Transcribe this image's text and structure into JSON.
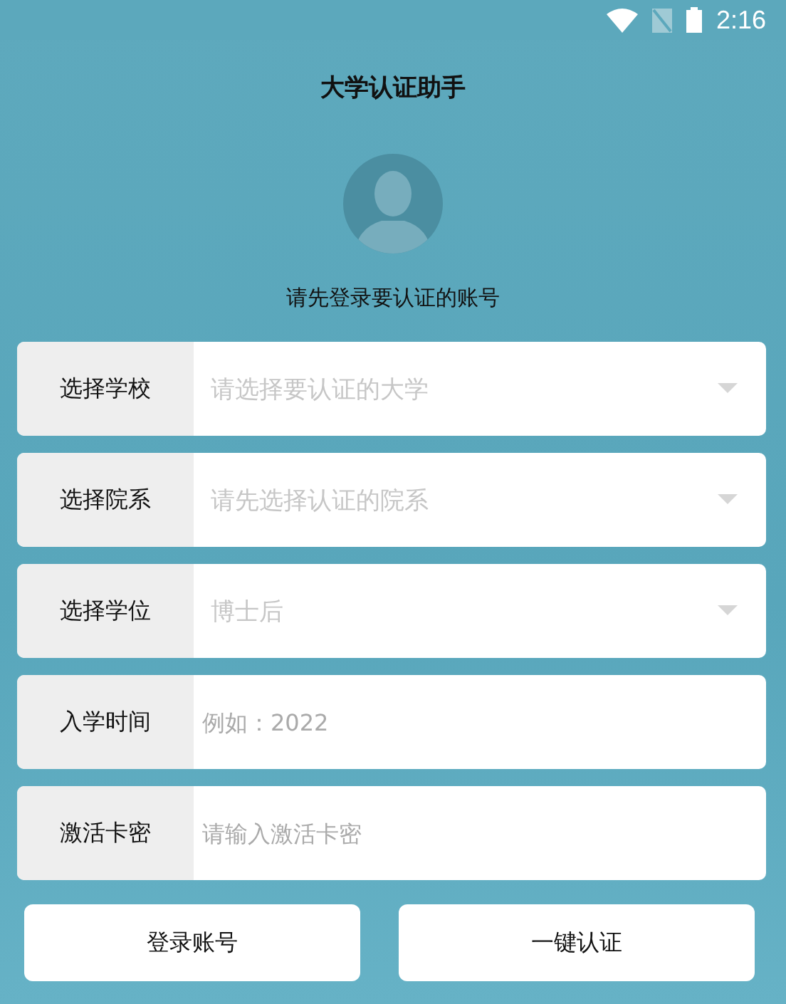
{
  "status_bar": {
    "time": "2:16"
  },
  "title": "大学认证助手",
  "subtitle": "请先登录要认证的账号",
  "fields": [
    {
      "kind": "dropdown",
      "label": "选择学校",
      "placeholder": "请选择要认证的大学"
    },
    {
      "kind": "dropdown",
      "label": "选择院系",
      "placeholder": "请先选择认证的院系"
    },
    {
      "kind": "dropdown",
      "label": "选择学位",
      "placeholder": "博士后"
    },
    {
      "kind": "input",
      "label": "入学时间",
      "placeholder": "例如：2022"
    },
    {
      "kind": "input",
      "label": "激活卡密",
      "placeholder": "请输入激活卡密"
    }
  ],
  "buttons": [
    "登录账号",
    "一键认证"
  ]
}
